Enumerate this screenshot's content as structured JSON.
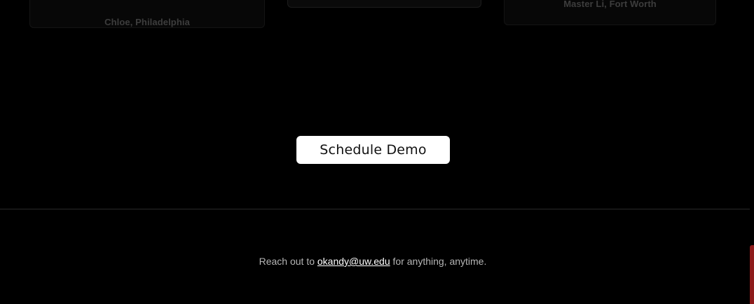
{
  "testimonials": [
    {
      "author": "Chloe, Philadelphia"
    },
    {
      "author": ""
    },
    {
      "author": "Master Li, Fort Worth"
    }
  ],
  "cta": {
    "label": "Schedule Demo"
  },
  "footer": {
    "prefix": "Reach out to ",
    "email": "okandy@uw.edu",
    "suffix": " for anything, anytime."
  },
  "colors": {
    "background": "#000000",
    "cta_background": "#ffffff",
    "scrollbar_accent": "#8e1b1b"
  }
}
